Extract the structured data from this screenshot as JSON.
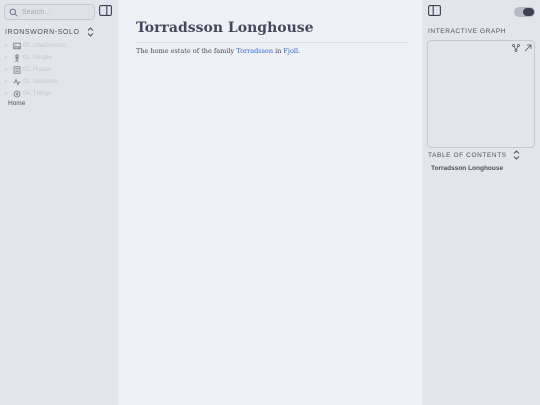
{
  "left_sidebar": {
    "search": {
      "placeholder": "Search..."
    },
    "vault_name": "IRONSWORN-SOLO",
    "tree": [
      {
        "label": "00. Attachments",
        "icon": "image-icon"
      },
      {
        "label": "01. People",
        "icon": "person-icon"
      },
      {
        "label": "02. Places",
        "icon": "map-icon"
      },
      {
        "label": "03. Sessions",
        "icon": "activity-icon"
      },
      {
        "label": "04. Things",
        "icon": "cube-icon"
      }
    ],
    "home_link": "Home"
  },
  "main": {
    "title": "Torradsson Longhouse",
    "paragraph": {
      "before": "The home estate of the family ",
      "link1": "Torradsson",
      "middle": " in ",
      "link2": "Fjoll",
      "after": "."
    }
  },
  "right_sidebar": {
    "graph_label": "INTERACTIVE GRAPH",
    "toc_label": "TABLE OF CONTENTS",
    "toc_items": [
      "Torradsson Longhouse"
    ]
  },
  "colors": {
    "accent_link": "#2f64c9",
    "sidebar_bg": "#e3e5ec",
    "main_bg": "#eff0f5",
    "text": "#45485a"
  }
}
